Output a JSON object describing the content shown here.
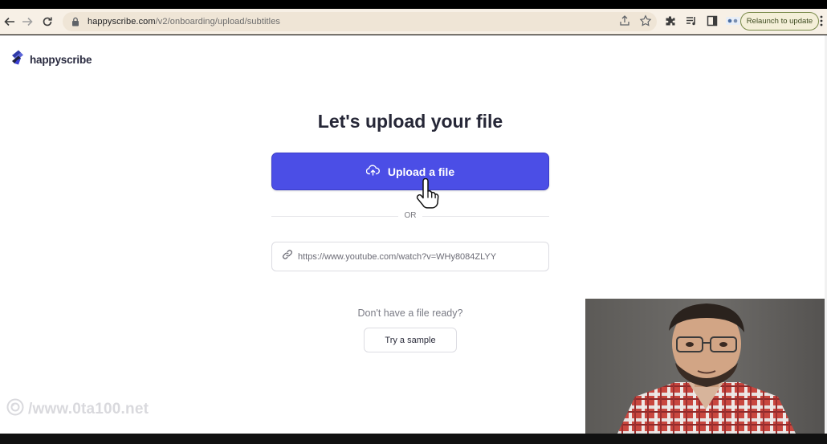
{
  "browser": {
    "url_domain": "happyscribe.com",
    "url_path": "/v2/onboarding/upload/subtitles",
    "relaunch_label": "Relaunch to update"
  },
  "logo": {
    "text": "happyscribe"
  },
  "main": {
    "title": "Let's upload your file",
    "upload_button": "Upload a file",
    "or_label": "OR",
    "url_input_value": "https://www.youtube.com/watch?v=WHy8084ZLYY",
    "no_file_text": "Don't have a file ready?",
    "sample_button": "Try a sample"
  },
  "watermark": {
    "text": "/www.0ta100.net"
  },
  "colors": {
    "accent": "#4b4ee6",
    "title": "#262737"
  },
  "icons": [
    "back-icon",
    "forward-icon",
    "reload-icon",
    "lock-icon",
    "share-icon",
    "star-icon",
    "extensions-icon",
    "media-icon",
    "sidepanel-icon",
    "upload-cloud-icon",
    "link-icon",
    "hand-cursor-icon"
  ]
}
